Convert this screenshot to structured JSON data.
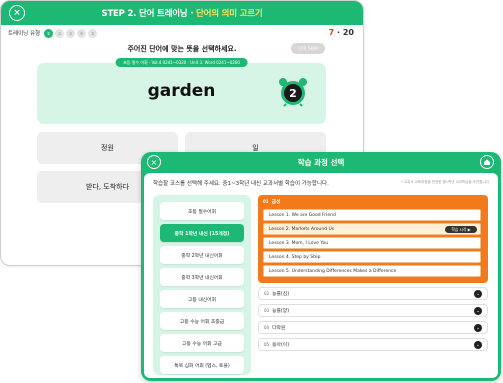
{
  "trainer": {
    "title_prefix": "STEP 2. 단어 트레이닝 · ",
    "title_highlight": "단어의 의미 고르기",
    "close_glyph": "×",
    "type_label": "트레이닝 유형",
    "type_icons": [
      "①",
      "②",
      "③",
      "④",
      "⑤"
    ],
    "counter_current": "7",
    "counter_sep": " · ",
    "counter_total": "20",
    "prompt": "주어진 단어에 맞는 뜻을 선택하세요.",
    "skip_label": "단어 SKIP",
    "breadcrumb": "초등 필수 어휘 · Vol.4 0241~0320 · Unit 3. Word 0241~0260",
    "word": "garden",
    "timer_value": "2",
    "options": [
      "정원",
      "일",
      "받다, 도착하다",
      ""
    ]
  },
  "course": {
    "title": "학습 과정 선택",
    "close_glyph": "×",
    "instruction": "학습할 코스를 선택해 주세요. 중1~3학년 내신 교과서별 학습이 가능합니다.",
    "note": "* 교과서 교육과정을 반영한 중1학년 교과학습을 추천합니다.",
    "categories": [
      {
        "label": "초등 필수어휘",
        "active": false
      },
      {
        "label": "중학 1학년 내신 (15개정)",
        "active": true
      },
      {
        "label": "중학 2학년 내신어휘",
        "active": false
      },
      {
        "label": "중학 3학년 내신어휘",
        "active": false
      },
      {
        "label": "고등 내신어휘",
        "active": false
      },
      {
        "label": "고등 수능 어휘 초중급",
        "active": false
      },
      {
        "label": "고등 수능 어휘 고급",
        "active": false
      },
      {
        "label": "특목 심화 어휘 (텝스, 토플)",
        "active": false
      }
    ],
    "open_group": {
      "tag": "01",
      "label": "금성"
    },
    "lessons": [
      "Lesson 1. We are Good Friend",
      "Lesson 2. Markets Around Us",
      "Lesson 3. Mom, I Love You",
      "Lesson 4. Step by Step",
      "Lesson 5. Understanding Differences Makes a Difference"
    ],
    "start_label": "학습 시작 ▶",
    "groups": [
      {
        "tag": "02",
        "label": "능률(김)"
      },
      {
        "tag": "03",
        "label": "능률(양)"
      },
      {
        "tag": "04",
        "label": "다락원"
      },
      {
        "tag": "05",
        "label": "동아(이)"
      }
    ],
    "chevron": "⌄"
  }
}
